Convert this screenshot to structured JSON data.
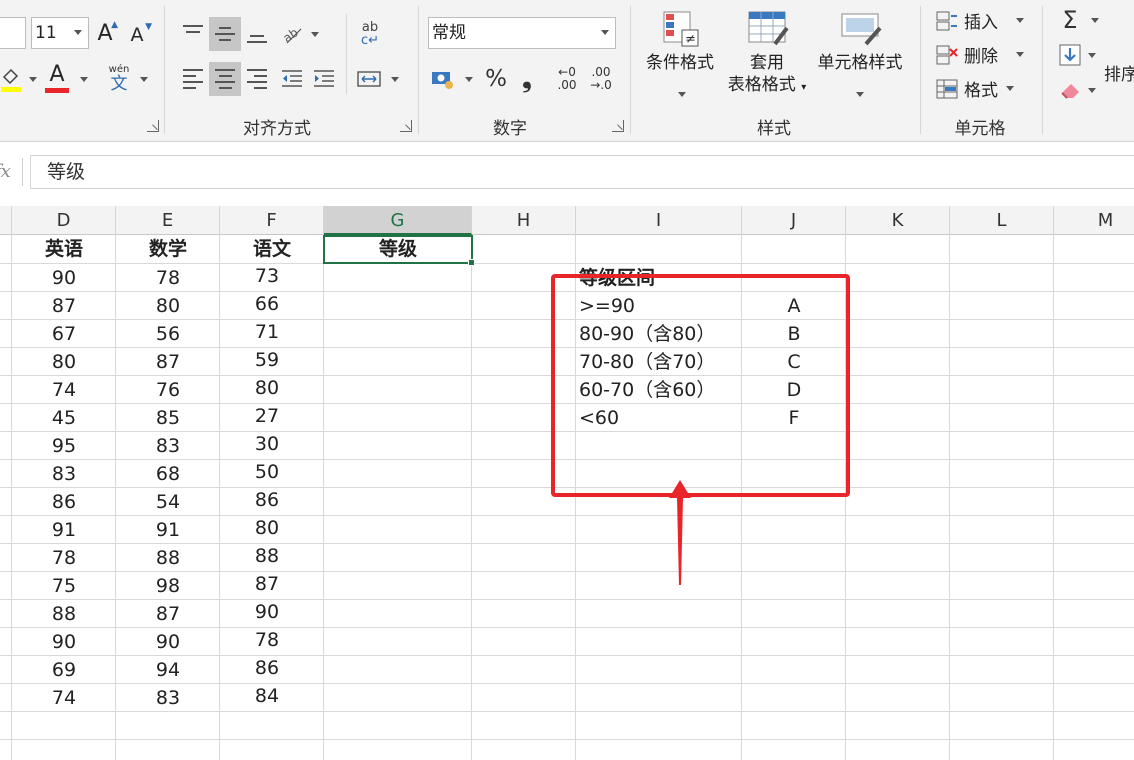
{
  "ribbon": {
    "font_size": "11",
    "font_grow_label": "A",
    "font_shrink_label": "A",
    "font_color_label": "A",
    "phonetic_top": "wén",
    "phonetic_bottom": "文",
    "wrap_top": "ab",
    "wrap_bottom": "c↵",
    "number_format": "常规",
    "percent_label": "%",
    "comma_label": "❟",
    "inc_decimal_top": "←0",
    "inc_decimal_bottom": ".00",
    "dec_decimal_top": ".00",
    "dec_decimal_bottom": "→.0",
    "groups": {
      "alignment": "对齐方式",
      "number": "数字",
      "styles": "样式",
      "cells": "单元格"
    },
    "styles": {
      "conditional": "条件格式",
      "table_line1": "套用",
      "table_line2": "表格格式",
      "cell_styles": "单元格样式"
    },
    "cells": {
      "insert": "插入",
      "delete": "删除",
      "format": "格式"
    },
    "editing": {
      "autosum": "Σ",
      "sort_partial": "排序"
    }
  },
  "formula_bar": {
    "fx": "fx",
    "value": "等级"
  },
  "columns": [
    "D",
    "E",
    "F",
    "G",
    "H",
    "I",
    "J",
    "K",
    "L",
    "M"
  ],
  "active_column": "G",
  "table": {
    "headers": [
      "英语",
      "数学",
      "语文",
      "等级"
    ],
    "rows": [
      [
        "90",
        "78",
        "73"
      ],
      [
        "87",
        "80",
        "66"
      ],
      [
        "67",
        "56",
        "71"
      ],
      [
        "80",
        "87",
        "59"
      ],
      [
        "74",
        "76",
        "80"
      ],
      [
        "45",
        "85",
        "27"
      ],
      [
        "95",
        "83",
        "30"
      ],
      [
        "83",
        "68",
        "50"
      ],
      [
        "86",
        "54",
        "86"
      ],
      [
        "91",
        "91",
        "80"
      ],
      [
        "78",
        "88",
        "88"
      ],
      [
        "75",
        "98",
        "87"
      ],
      [
        "88",
        "87",
        "90"
      ],
      [
        "90",
        "90",
        "78"
      ],
      [
        "69",
        "94",
        "86"
      ],
      [
        "74",
        "83",
        "84"
      ]
    ]
  },
  "grade_table": {
    "title": "等级区间",
    "rows": [
      {
        "range": ">=90",
        "grade": "A"
      },
      {
        "range": "80-90（含80）",
        "grade": "B"
      },
      {
        "range": "70-80（含70）",
        "grade": "C"
      },
      {
        "range": "60-70（含60）",
        "grade": "D"
      },
      {
        "range": "<60",
        "grade": "F"
      }
    ]
  },
  "colors": {
    "excel_green": "#217346",
    "highlight_red": "#e8262a"
  }
}
